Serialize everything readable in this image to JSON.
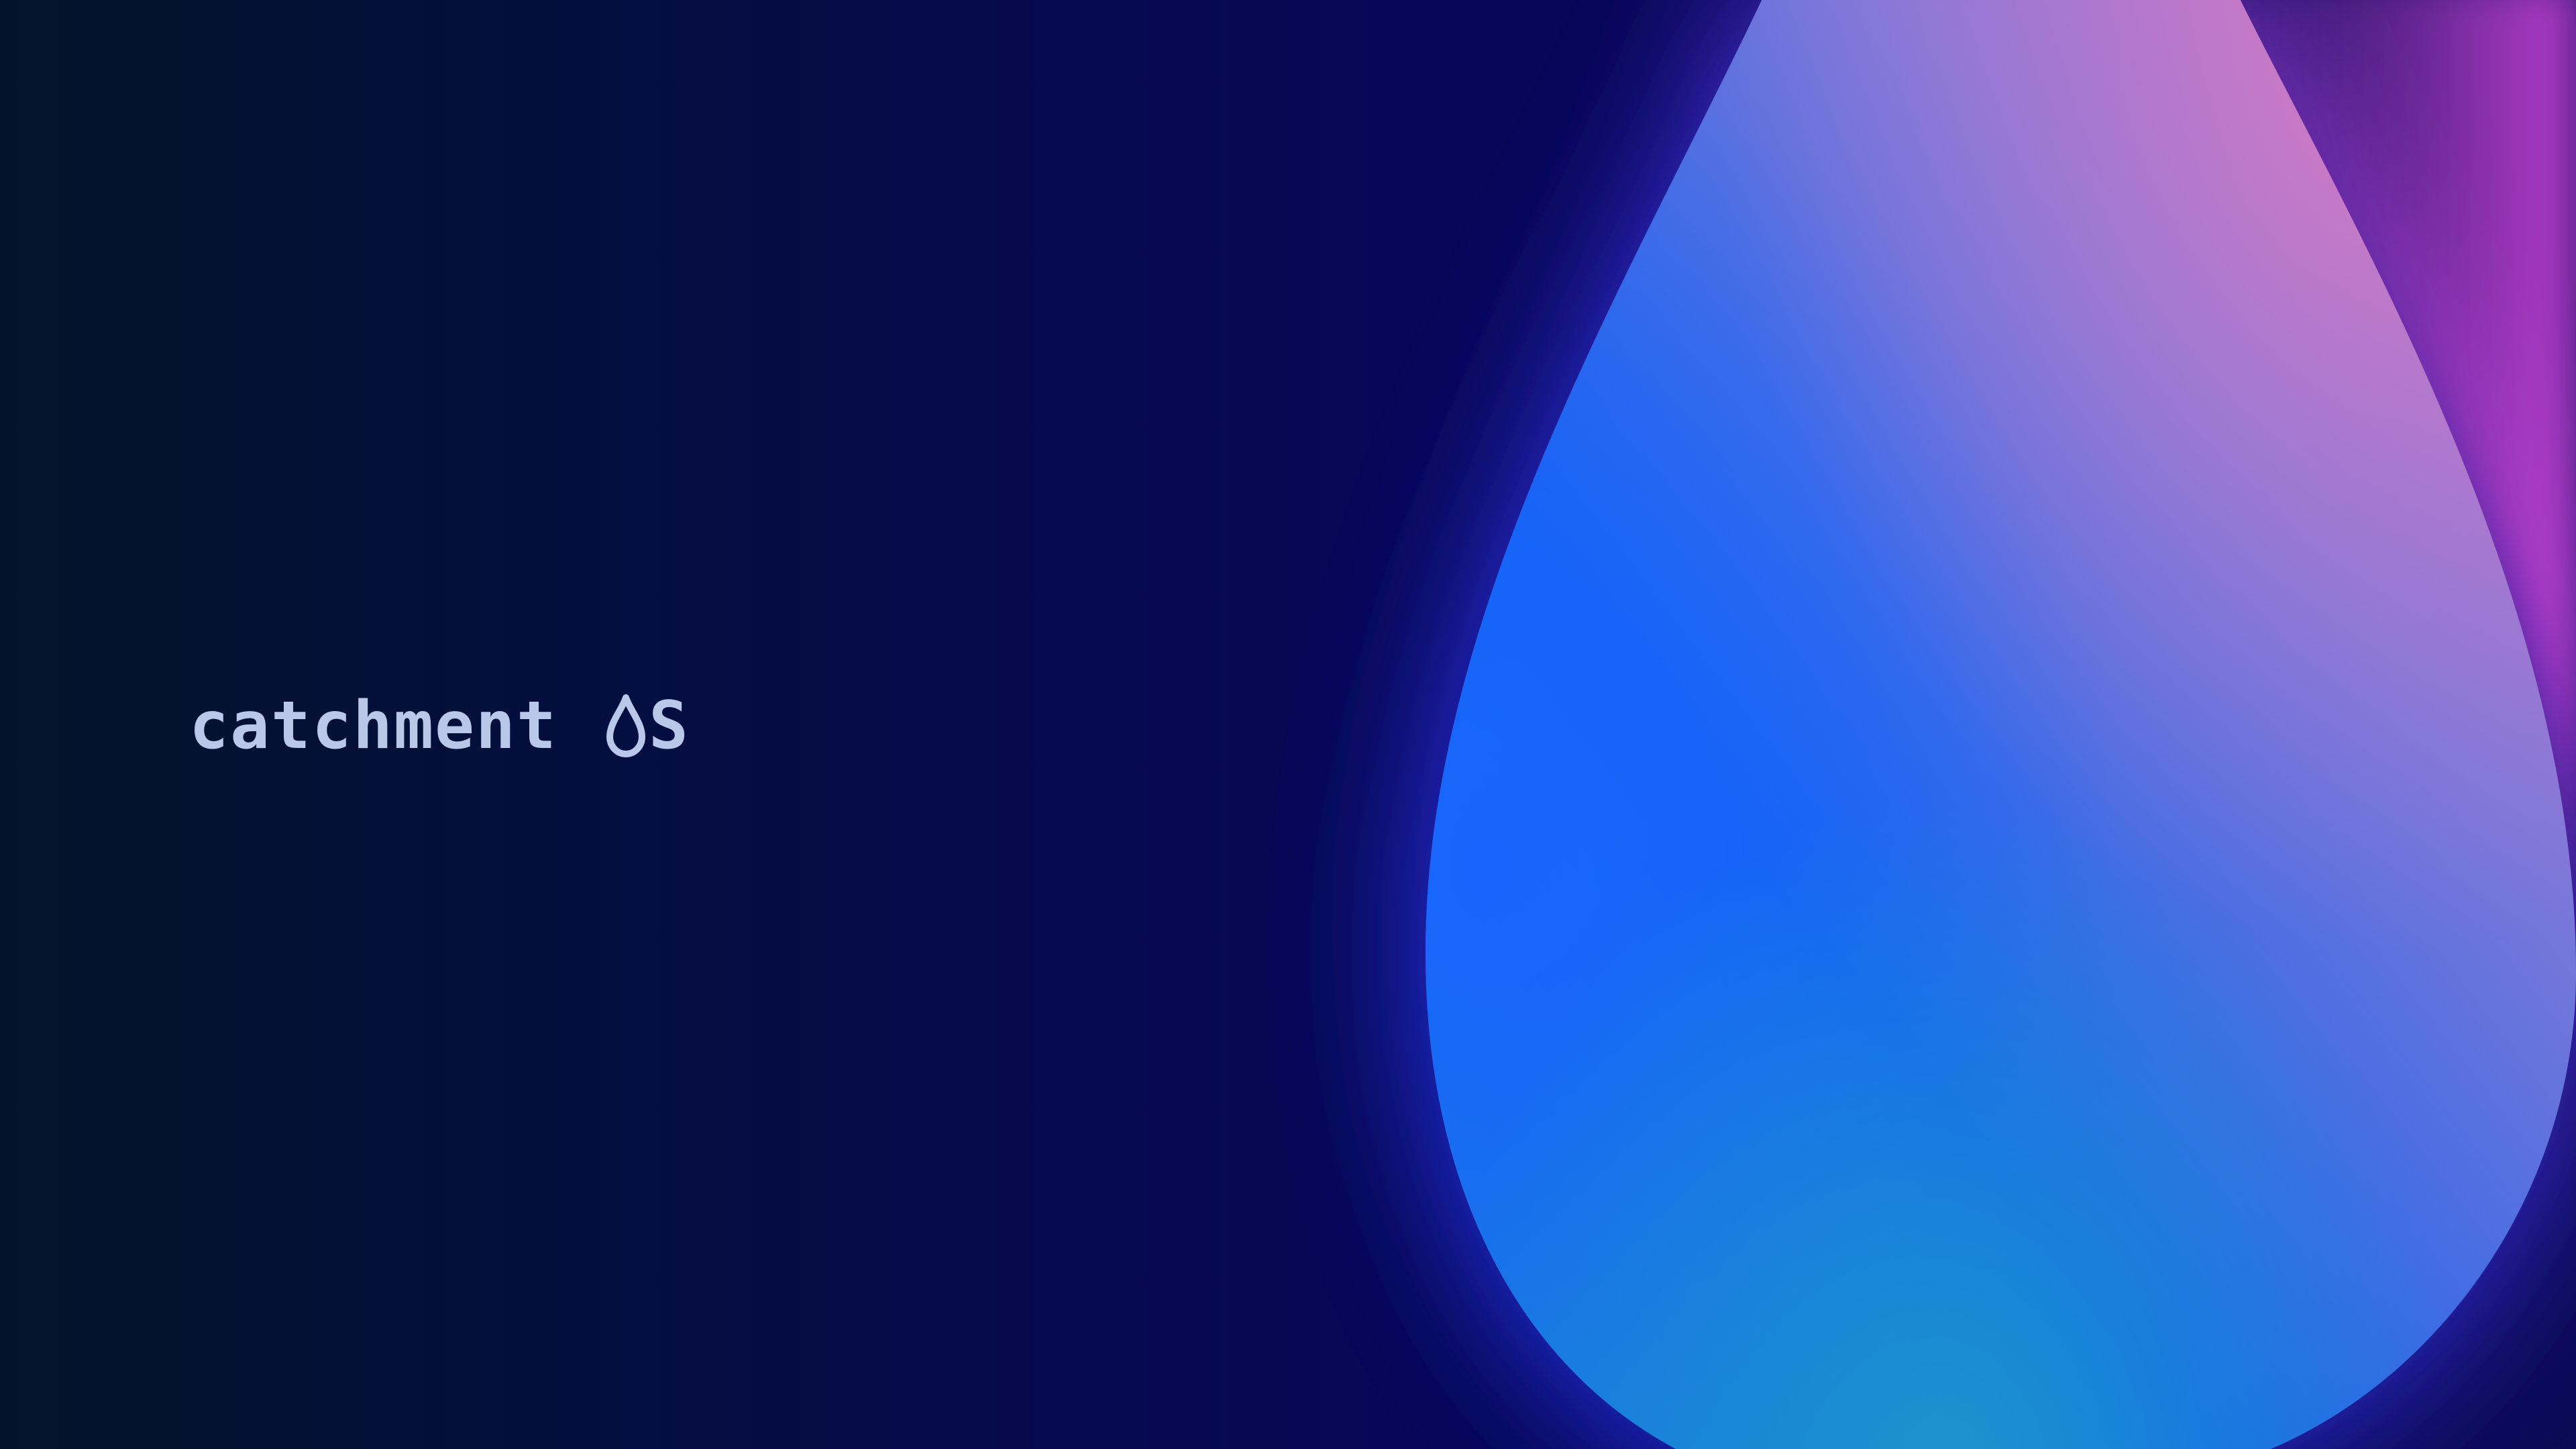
{
  "wallpaper": {
    "background_colors": [
      "#03142a",
      "#060a4f",
      "#0b0a55"
    ],
    "drop_colors": [
      "#1560f5",
      "#1a8ad0",
      "#b07ad0",
      "#e255e0"
    ]
  },
  "logo": {
    "word": "catchment",
    "icon": "water-drop-icon",
    "suffix": "S"
  }
}
